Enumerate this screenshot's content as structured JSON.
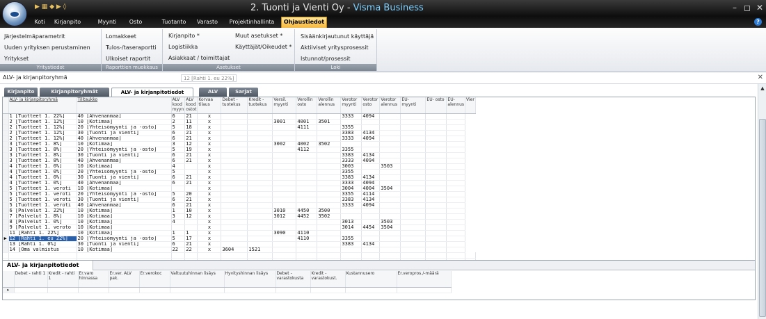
{
  "window": {
    "title_prefix": "2. Tuonti ja Vienti Oy - ",
    "title_app": "Visma Business",
    "minimize": "–",
    "restore": "◻",
    "close": "✕"
  },
  "ribbon_tabs": [
    "Koti",
    "Kirjanpito",
    "Myynti",
    "Osto",
    "Tuotanto",
    "Varasto",
    "Projektinhallinta",
    "Ohjaustiedot"
  ],
  "ribbon_groups": [
    {
      "label": "Yritystiedot",
      "items": [
        "Järjestelmäparametrit",
        "Uuden yrityksen perustaminen",
        "Yritykset"
      ]
    },
    {
      "label": "Raporttien muokkaus",
      "items": [
        "Lomakkeet",
        "Tulos-/taseraportti",
        "Ulkoiset raportit"
      ]
    },
    {
      "label": "Asetukset",
      "items": [
        "Kirjanpito *",
        "Logistiikka",
        "Asiakkaat / toimittajat",
        "Muut asetukset *",
        "Käyttäjät/Oikeudet *"
      ]
    },
    {
      "label": "Loki",
      "items": [
        "Sisäänkirjautunut käyttäjä",
        "Aktiiviset yritysprosessit",
        "Istunnot/prosessit"
      ]
    }
  ],
  "path": {
    "label": "ALV- ja kirjanpitoryhmä",
    "value": "12 [Rahti 1. eu 22%]",
    "close": "✕"
  },
  "subtabs": [
    "Kirjanpito",
    "Kirjanpitoryhmät",
    "ALV- ja kirjanpitotiedot",
    "ALV",
    "Sarjat"
  ],
  "grid": {
    "headers": [
      "ALV- ja kirjanpitoryhmä",
      "Tilitaukko",
      "ALV kood myyn",
      "ALV kood ostot",
      "Korvaa tilaus",
      "Debet - tuotekus",
      "Kredit - tuotekus",
      "Versil. myynti",
      "Verollin osto",
      "Verollin alennus",
      "Verotor myynti",
      "Verotor osto",
      "Verotor alennus",
      "EU- myynti",
      "EU- osto",
      "EU- alennus",
      "Vier"
    ],
    "rows": [
      [
        "",
        "1 [Tuotteet 1. 22%]",
        "40 [Ahvenanmaa]",
        "6",
        "21",
        "x",
        "",
        "",
        "",
        "",
        "",
        "3333",
        "4094",
        "",
        "",
        "",
        ""
      ],
      [
        "",
        "2 [Tuotteet 1. 12%]",
        "10 [Kotimaa]",
        "2",
        "11",
        "x",
        "",
        "",
        "3001",
        "4001",
        "3501",
        "",
        "",
        "",
        "",
        "",
        ""
      ],
      [
        "",
        "2 [Tuotteet 1. 12%]",
        "20 [Yhteisömyynti ja -osto]",
        "5",
        "18",
        "x",
        "",
        "",
        "",
        "4111",
        "",
        "3355",
        "",
        "",
        "",
        "",
        ""
      ],
      [
        "",
        "2 [Tuotteet 1. 12%]",
        "30 [Tuonti ja vienti]",
        "6",
        "21",
        "x",
        "",
        "",
        "",
        "",
        "",
        "3383",
        "4134",
        "",
        "",
        "",
        ""
      ],
      [
        "",
        "2 [Tuotteet 1. 12%]",
        "40 [Ahvenanmaa]",
        "6",
        "21",
        "x",
        "",
        "",
        "",
        "",
        "",
        "3333",
        "4094",
        "",
        "",
        "",
        ""
      ],
      [
        "",
        "3 [Tuotteet 1. 8%]",
        "10 [Kotimaa]",
        "3",
        "12",
        "x",
        "",
        "",
        "3002",
        "4002",
        "3502",
        "",
        "",
        "",
        "",
        "",
        ""
      ],
      [
        "",
        "3 [Tuotteet 1. 8%]",
        "20 [Yhteisömyynti ja -osto]",
        "5",
        "19",
        "x",
        "",
        "",
        "",
        "4112",
        "",
        "3355",
        "",
        "",
        "",
        "",
        ""
      ],
      [
        "",
        "3 [Tuotteet 1. 8%]",
        "30 [Tuonti ja vienti]",
        "6",
        "21",
        "x",
        "",
        "",
        "",
        "",
        "",
        "3383",
        "4134",
        "",
        "",
        "",
        ""
      ],
      [
        "",
        "3 [Tuotteet 1. 8%]",
        "40 [Ahvenanmaa]",
        "6",
        "21",
        "x",
        "",
        "",
        "",
        "",
        "",
        "3333",
        "4094",
        "",
        "",
        "",
        ""
      ],
      [
        "",
        "4 [Tuotteet 1. 0%]",
        "10 [Kotimaa]",
        "4",
        "",
        "x",
        "",
        "",
        "",
        "",
        "",
        "3003",
        "",
        "3503",
        "",
        "",
        ""
      ],
      [
        "",
        "4 [Tuotteet 1. 0%]",
        "20 [Yhteisömyynti ja -osto]",
        "5",
        "",
        "x",
        "",
        "",
        "",
        "",
        "",
        "3355",
        "",
        "",
        "",
        "",
        ""
      ],
      [
        "",
        "4 [Tuotteet 1. 0%]",
        "30 [Tuonti ja vienti]",
        "6",
        "21",
        "x",
        "",
        "",
        "",
        "",
        "",
        "3383",
        "4134",
        "",
        "",
        "",
        ""
      ],
      [
        "",
        "4 [Tuotteet 1. 0%]",
        "40 [Ahvenanmaa]",
        "6",
        "21",
        "x",
        "",
        "",
        "",
        "",
        "",
        "3333",
        "4094",
        "",
        "",
        "",
        ""
      ],
      [
        "",
        "5 [Tuotteet 1. veroti",
        "10 [Kotimaa]",
        "",
        "",
        "x",
        "",
        "",
        "",
        "",
        "",
        "3004",
        "4004",
        "3504",
        "",
        "",
        ""
      ],
      [
        "",
        "5 [Tuotteet 1. veroti",
        "20 [Yhteisömyynti ja -osto]",
        "5",
        "20",
        "x",
        "",
        "",
        "",
        "",
        "",
        "3355",
        "4114",
        "",
        "",
        "",
        ""
      ],
      [
        "",
        "5 [Tuotteet 1. veroti",
        "30 [Tuonti ja vienti]",
        "6",
        "21",
        "x",
        "",
        "",
        "",
        "",
        "",
        "3383",
        "4134",
        "",
        "",
        "",
        ""
      ],
      [
        "",
        "5 [Tuotteet 1. veroti",
        "40 [Ahvenanmaa]",
        "6",
        "21",
        "x",
        "",
        "",
        "",
        "",
        "",
        "3333",
        "4094",
        "",
        "",
        "",
        ""
      ],
      [
        "",
        "6 [Palvelut 1. 22%]",
        "10 [Kotimaa]",
        "1",
        "10",
        "x",
        "",
        "",
        "3010",
        "4450",
        "3500",
        "",
        "",
        "",
        "",
        "",
        ""
      ],
      [
        "",
        "7 [Palvelut 1. 8%]",
        "10 [Kotimaa]",
        "3",
        "12",
        "x",
        "",
        "",
        "3012",
        "4452",
        "3502",
        "",
        "",
        "",
        "",
        "",
        ""
      ],
      [
        "",
        "8 [Palvelut 1. 0%]",
        "10 [Kotimaa]",
        "4",
        "",
        "x",
        "",
        "",
        "",
        "",
        "",
        "3013",
        "",
        "3503",
        "",
        "",
        ""
      ],
      [
        "",
        "9 [Palvelut 1. veroto",
        "10 [Kotimaa]",
        "",
        "",
        "x",
        "",
        "",
        "",
        "",
        "",
        "3014",
        "4454",
        "3504",
        "",
        "",
        ""
      ],
      [
        "",
        "11 [Rahti 1. 22%]",
        "10 [Kotimaa]",
        "1",
        "1",
        "x",
        "",
        "",
        "3090",
        "4110",
        "",
        "",
        "",
        "",
        "",
        "",
        ""
      ],
      [
        "▶",
        "12 [Rahti 1. eu 22%]",
        "20 [Yhteisömyynti ja -osto]",
        "5",
        "17",
        "x",
        "",
        "",
        "",
        "4110",
        "",
        "3355",
        "",
        "",
        "",
        "",
        ""
      ],
      [
        "",
        "13 [Rahti 1. 0%]",
        "30 [Tuonti ja vienti]",
        "6",
        "21",
        "x",
        "",
        "",
        "",
        "",
        "",
        "3383",
        "4134",
        "",
        "",
        "",
        ""
      ],
      [
        "",
        "14 [Oma valmistus",
        "10 [Kotimaa]",
        "22",
        "22",
        "x",
        "3604",
        "1521",
        "",
        "",
        "",
        "",
        "",
        "",
        "",
        "",
        ""
      ]
    ],
    "selected_row": 22
  },
  "lower": {
    "tab": "ALV- ja kirjanpitotiedot",
    "headers": [
      "",
      "Debet - rahti 1",
      "Kredit - rahti 1",
      "Er.varo hinnassa",
      "Er.ver. ALV pak.",
      "Er.verokoc",
      "Valtuutuhinnan lisäys",
      "Hyvityshinnan lisäys",
      "Debet - varastokusta",
      "Kredit - varastokust.",
      "Kustannusero",
      "Er.veropros./-määrä"
    ],
    "row_marker": "▸"
  },
  "colors": {
    "active_tab": "#f6b73c",
    "title_accent": "#7ed0ff",
    "selection": "#2a5fa8"
  }
}
